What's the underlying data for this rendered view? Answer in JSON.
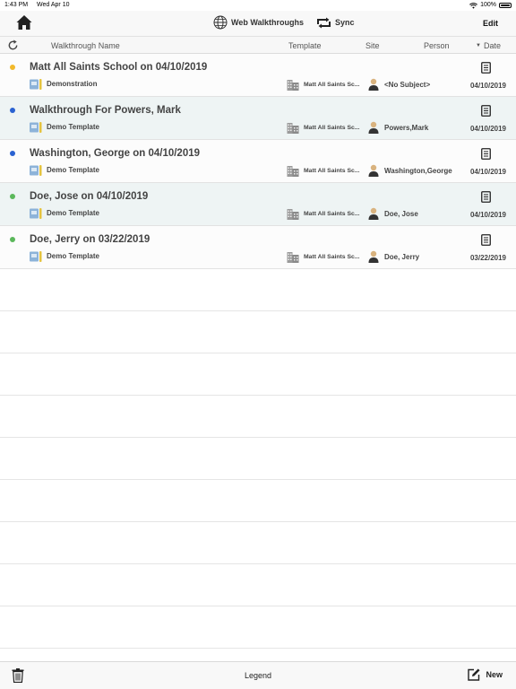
{
  "status_bar": {
    "time": "1:43 PM",
    "date": "Wed Apr 10",
    "battery": "100%"
  },
  "nav": {
    "web_walkthroughs_label": "Web Walkthroughs",
    "sync_label": "Sync",
    "edit_label": "Edit"
  },
  "columns": {
    "name": "Walkthrough Name",
    "template": "Template",
    "site": "Site",
    "person": "Person",
    "date": "Date",
    "sort_indicator": "▼"
  },
  "colors": {
    "status_yellow": "#f2b92b",
    "status_blue": "#2a62d1",
    "status_green": "#5bb85b"
  },
  "walkthroughs": [
    {
      "status_color": "#f2b92b",
      "title": "Matt All Saints School on 04/10/2019",
      "template": "Demonstration",
      "site": "Matt All Saints Sc...",
      "person": "<No Subject>",
      "date": "04/10/2019"
    },
    {
      "status_color": "#2a62d1",
      "title": "Walkthrough For Powers, Mark",
      "template": "Demo Template",
      "site": "Matt All Saints Sc...",
      "person": "Powers,Mark",
      "date": "04/10/2019"
    },
    {
      "status_color": "#2a62d1",
      "title": "Washington, George on 04/10/2019",
      "template": "Demo Template",
      "site": "Matt All Saints Sc...",
      "person": "Washington,George",
      "date": "04/10/2019"
    },
    {
      "status_color": "#5bb85b",
      "title": "Doe, Jose on 04/10/2019",
      "template": "Demo Template",
      "site": "Matt All Saints Sc...",
      "person": "Doe, Jose",
      "date": "04/10/2019"
    },
    {
      "status_color": "#5bb85b",
      "title": "Doe, Jerry on 03/22/2019",
      "template": "Demo Template",
      "site": "Matt All Saints Sc...",
      "person": "Doe, Jerry",
      "date": "03/22/2019"
    }
  ],
  "toolbar": {
    "legend_label": "Legend",
    "new_label": "New"
  }
}
